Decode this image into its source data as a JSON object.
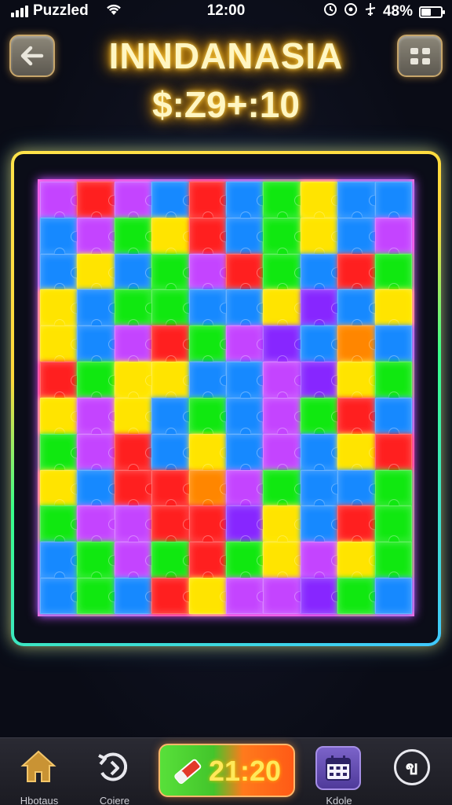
{
  "status_bar": {
    "carrier": "Puzzled",
    "time": "12:00",
    "battery": "48%",
    "battery_level": 0.48
  },
  "header": {
    "title": "INNDANASIA",
    "score": "$:Z9+:10"
  },
  "board": {
    "columns": 10,
    "rows": 12,
    "palette": {
      "P": "#b34cf0",
      "R": "#ff2a2a",
      "G": "#2fdc2f",
      "Y": "#ffe21a",
      "B": "#2a86ff",
      "V": "#7b2ef5",
      "O": "#ff8a1a",
      "M": "#e43ad8"
    },
    "pieces": [
      "PRPBRBGYBB",
      "BPGYRBGYBP",
      "BYBGPRGBRG",
      "YBGGBBYVBY",
      "YBPRGPVBOB",
      "RGYYBBPVYG",
      "YPYBGBPGRB",
      "GPRBYBPBYR",
      "YBRROPGBBG",
      "GPPRRVYBRG",
      "BGPGRGYPYG",
      "BGBRYPPVGB"
    ]
  },
  "bottom_nav": {
    "home_label": "Hbotaus",
    "restore_label": "Coiere",
    "timer": "21:20",
    "calendar_label": "Kdole",
    "settings_glyph": "ข"
  },
  "colors": {
    "title_glow": "#ffb000",
    "frame_yellow": "#ffe24a",
    "frame_cyan": "#40c8ff",
    "timer_green": "#43c52b",
    "timer_orange": "#ff5a16"
  }
}
